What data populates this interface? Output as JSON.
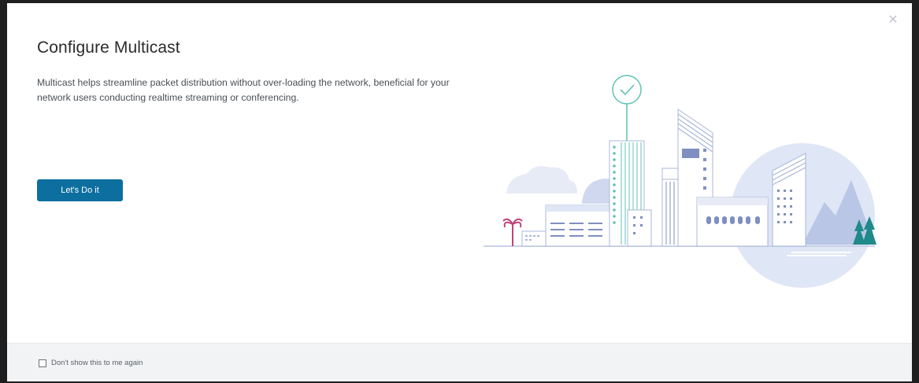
{
  "dialog": {
    "title": "Configure Multicast",
    "description": "Multicast helps streamline packet distribution without over-loading the network, beneficial for your network users conducting realtime streaming or conferencing.",
    "primary_button_label": "Let's Do it",
    "close_icon": "close-icon",
    "close_glyph": "✕"
  },
  "footer": {
    "checkbox_label": "Don't show this to me again",
    "checkbox_checked": false
  },
  "illustration": {
    "subject": "city-skyline-with-check-badge",
    "colors": {
      "accent_teal": "#5fc3b1",
      "light_blue": "#dfe6f5",
      "mid_blue": "#a9b7d9",
      "dark_blue": "#7f8fc0",
      "tree": "#1f8a8a",
      "palm": "#c0427a"
    }
  },
  "colors": {
    "primary_button": "#0d6fa0",
    "footer_bg": "#f2f3f5",
    "title_text": "#2b2b2b",
    "body_text": "#4a4f55"
  }
}
